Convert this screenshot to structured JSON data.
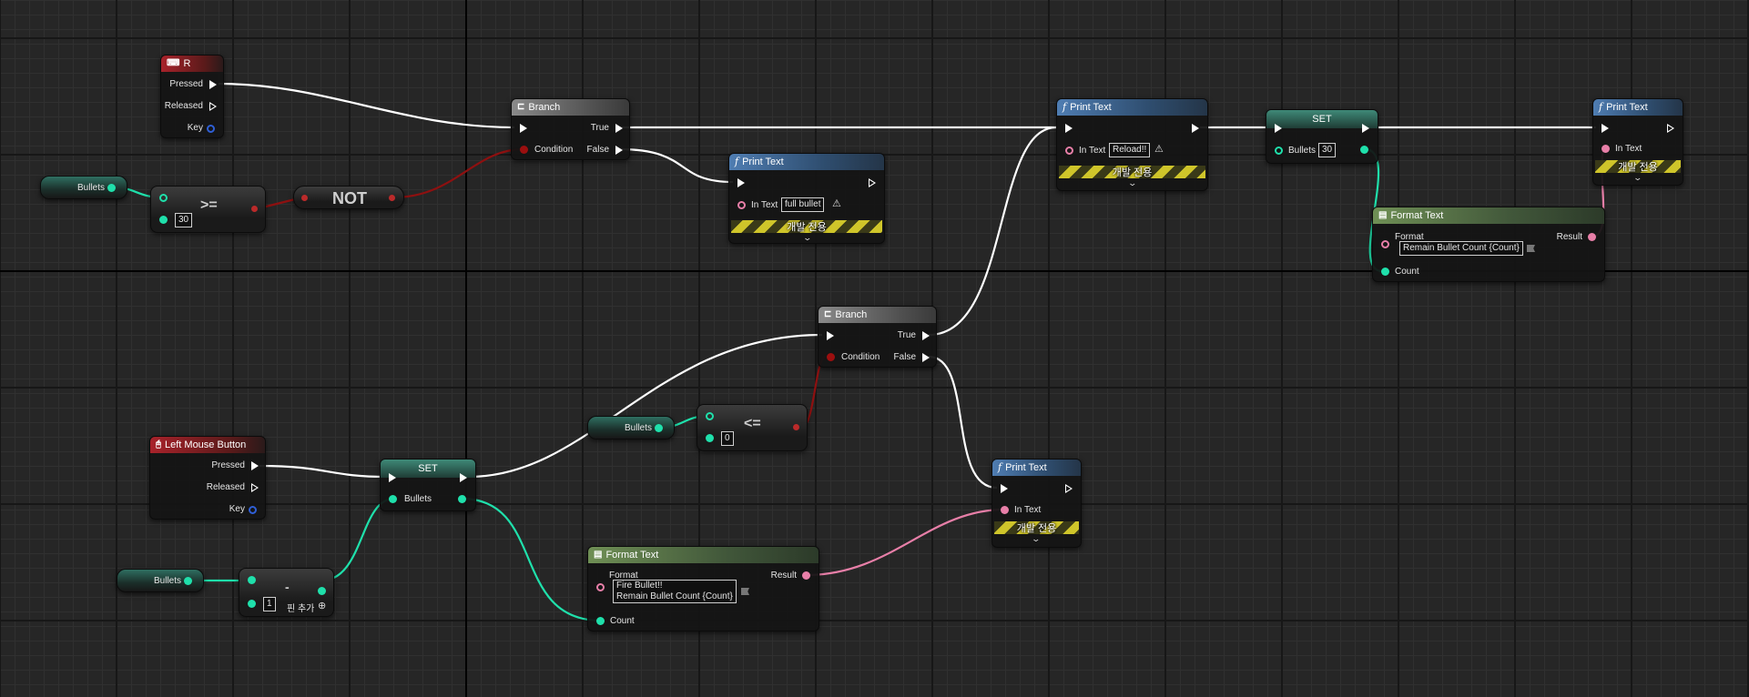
{
  "colors": {
    "exec": "#ffffff",
    "int": "#1fe0ab",
    "bool": "#9c0f0f",
    "text": "#e87fa8",
    "key": "#2f5fd6"
  },
  "icons": {
    "keyboard": "keyboard-icon",
    "mouse": "mouse-icon",
    "branch": "branch-icon",
    "function": "function-icon",
    "format": "format-text-icon",
    "warning": "warning-icon",
    "expand": "chevron-down-icon"
  },
  "nodes": {
    "key_r": {
      "title": "R",
      "pressed": "Pressed",
      "released": "Released",
      "key": "Key"
    },
    "bullets_get_top": {
      "label": "Bullets"
    },
    "gte": {
      "op": ">=",
      "value": "30"
    },
    "not": {
      "title": "NOT"
    },
    "branch1": {
      "title": "Branch",
      "true": "True",
      "false": "False",
      "condition": "Condition"
    },
    "print_full": {
      "title": "Print Text",
      "in_text_label": "In Text",
      "in_text_value": "full bullet",
      "dev_only": "개발 전용"
    },
    "print_reload": {
      "title": "Print Text",
      "in_text_label": "In Text",
      "in_text_value": "Reload!!",
      "dev_only": "개발 전용"
    },
    "set_top": {
      "title": "SET",
      "bullets_label": "Bullets",
      "bullets_value": "30"
    },
    "print_remain": {
      "title": "Print Text",
      "in_text_label": "In Text",
      "dev_only": "개발 전용"
    },
    "format_top": {
      "title": "Format Text",
      "format_label": "Format",
      "format_value": "Remain Bullet Count {Count}",
      "result_label": "Result",
      "count_label": "Count"
    },
    "branch2": {
      "title": "Branch",
      "true": "True",
      "false": "False",
      "condition": "Condition"
    },
    "bullets_get_mid": {
      "label": "Bullets"
    },
    "lte": {
      "op": "<=",
      "value": "0"
    },
    "lmb": {
      "title": "Left Mouse Button",
      "pressed": "Pressed",
      "released": "Released",
      "key": "Key"
    },
    "set_bottom": {
      "title": "SET",
      "bullets_label": "Bullets"
    },
    "bullets_get_bottom": {
      "label": "Bullets"
    },
    "subtract": {
      "op": "-",
      "value": "1",
      "add_pin": "핀 추가"
    },
    "format_bottom": {
      "title": "Format Text",
      "format_label": "Format",
      "format_line1": "Fire Bullet!!",
      "format_line2": "Remain Bullet Count {Count}",
      "result_label": "Result",
      "count_label": "Count"
    },
    "print_fire": {
      "title": "Print Text",
      "in_text_label": "In Text",
      "dev_only": "개발 전용"
    }
  }
}
